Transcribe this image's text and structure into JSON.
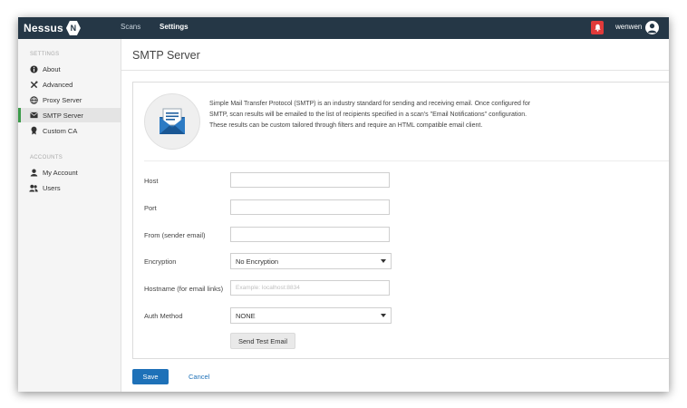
{
  "header": {
    "logo_text": "Nessus",
    "logo_badge": "N",
    "nav": [
      {
        "label": "Scans"
      },
      {
        "label": "Settings"
      }
    ],
    "username": "wenwen"
  },
  "sidebar": {
    "settings_heading": "SETTINGS",
    "settings_items": [
      {
        "label": "About",
        "icon": "info-icon"
      },
      {
        "label": "Advanced",
        "icon": "tools-icon"
      },
      {
        "label": "Proxy Server",
        "icon": "globe-icon"
      },
      {
        "label": "SMTP Server",
        "icon": "envelope-icon"
      },
      {
        "label": "Custom CA",
        "icon": "certificate-icon"
      }
    ],
    "accounts_heading": "ACCOUNTS",
    "accounts_items": [
      {
        "label": "My Account",
        "icon": "user-icon"
      },
      {
        "label": "Users",
        "icon": "users-icon"
      }
    ]
  },
  "page": {
    "title": "SMTP Server",
    "description": "Simple Mail Transfer Protocol (SMTP) is an industry standard for sending and receiving email. Once configured for SMTP, scan results will be emailed to the list of recipients specified in a scan's \"Email Notifications\" configuration. These results can be custom tailored through filters and require an HTML compatible email client."
  },
  "form": {
    "host": {
      "label": "Host",
      "value": "",
      "placeholder": ""
    },
    "port": {
      "label": "Port",
      "value": "",
      "placeholder": ""
    },
    "from": {
      "label": "From (sender email)",
      "value": "",
      "placeholder": ""
    },
    "encryption": {
      "label": "Encryption",
      "selected": "No Encryption"
    },
    "hostname": {
      "label": "Hostname (for email links)",
      "value": "",
      "placeholder": "Example: localhost:8834"
    },
    "auth_method": {
      "label": "Auth Method",
      "selected": "NONE"
    },
    "test_button": "Send Test Email"
  },
  "footer": {
    "save_label": "Save",
    "cancel_label": "Cancel"
  },
  "colors": {
    "topbar": "#253746",
    "accent": "#1e71b8",
    "active_marker": "#3c9b4a",
    "notification": "#e03a3a"
  }
}
